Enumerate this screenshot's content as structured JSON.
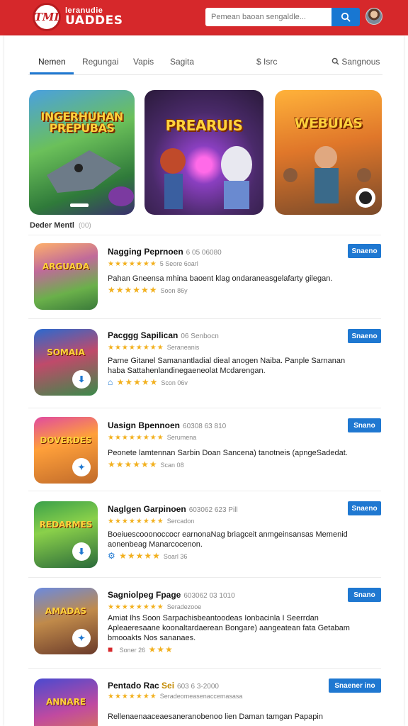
{
  "header": {
    "logo_text": "TMI",
    "brand_line1": "leranudie",
    "brand_line2": "UADDES",
    "search_placeholder": "Pemean baoan sengaldle...",
    "search_icon": "search-icon",
    "avatar_icon": "user-avatar"
  },
  "tabs": [
    {
      "label": "Nemen",
      "active": true
    },
    {
      "label": "Regungai"
    },
    {
      "label": "Vapis"
    },
    {
      "label": "Sagita"
    },
    {
      "label": "$ Isrc"
    },
    {
      "label": "Sangnous",
      "icon": "search-icon"
    }
  ],
  "heroes": [
    {
      "title": "INGERHUHAN\nPREPUBAS"
    },
    {
      "title": "PREARUIS"
    },
    {
      "title": "WEBUIAS"
    }
  ],
  "section": {
    "label": "Deder Mentl",
    "count": "(00)"
  },
  "items": [
    {
      "title": "Nagging Peprnoen",
      "meta": "6 05 06080",
      "stars_label": "5 Seore 6oarl",
      "desc": "Pahan Gneensa mhina baoent klag ondaraneasgelafarty gilegan.",
      "stars2_label": "Soon 86y",
      "button": "Snaeno",
      "art": "thumb-1",
      "thumb_title": "ARGUADA"
    },
    {
      "title": "Pacggg Sapilican",
      "meta": "06 Senbocn",
      "stars_label": "Seraneanis",
      "desc": "Parne Gitanel Samanantladial dieal anogen Naiba. Panple Sarnanan haba Sattahenlandinegaeneolat Mcdarengan.",
      "stars2_label": "Scon 06v",
      "button": "Snaeno",
      "art": "thumb-2",
      "thumb_title": "SOMAIA"
    },
    {
      "title": "Uasign Bpennoen",
      "meta": "60308 63 810",
      "stars_label": "Serumena",
      "desc": "Peonete lamtennan Sarbin Doan Sancena) tanotneis (apngeSadedat.",
      "stars2_label": "Scan 08",
      "button": "Snano",
      "art": "thumb-3",
      "thumb_title": "DOVERDES"
    },
    {
      "title": "Naglgen Garpinoen",
      "meta": "603062 623 Pill",
      "stars_label": "Sercadon",
      "desc": "Boeiuescooonoccocr earnonaNag briagceit anmgeinsansas Memenid aonenbeag Manarcocenon.",
      "stars2_label": "Soarl 36",
      "button": "Snaeno",
      "art": "thumb-4",
      "thumb_title": "REDARMES"
    },
    {
      "title": "Sagniolpeg Fpage",
      "meta": "603062 03 1010",
      "stars_label": "Seradezooe",
      "desc": "Amiat Ihs Soon Sarpachisbeantoodeas Ionbacinla I Seerrdan Apleaeresaane koonaltardaerean Bongare) aangeatean fata Getabam bmooakts Nos sananaes.",
      "stars2_label": "Soner 26",
      "button": "Snano",
      "art": "thumb-5",
      "thumb_title": "AMADAS"
    },
    {
      "title": "Pentado Rac",
      "title_highlight": "Sei",
      "meta": "603 6 3-2000",
      "stars_label": "Seradeomeasenaccemasasa",
      "desc": "Rellenaenaaceaesaneranobenoo lien Daman tamgan Papapin",
      "button": "Snaener ino",
      "art": "thumb-6",
      "thumb_title": "ANNARE"
    }
  ],
  "colors": {
    "header": "#d6282b",
    "accent": "#1f78d1",
    "star": "#f2b01e"
  }
}
